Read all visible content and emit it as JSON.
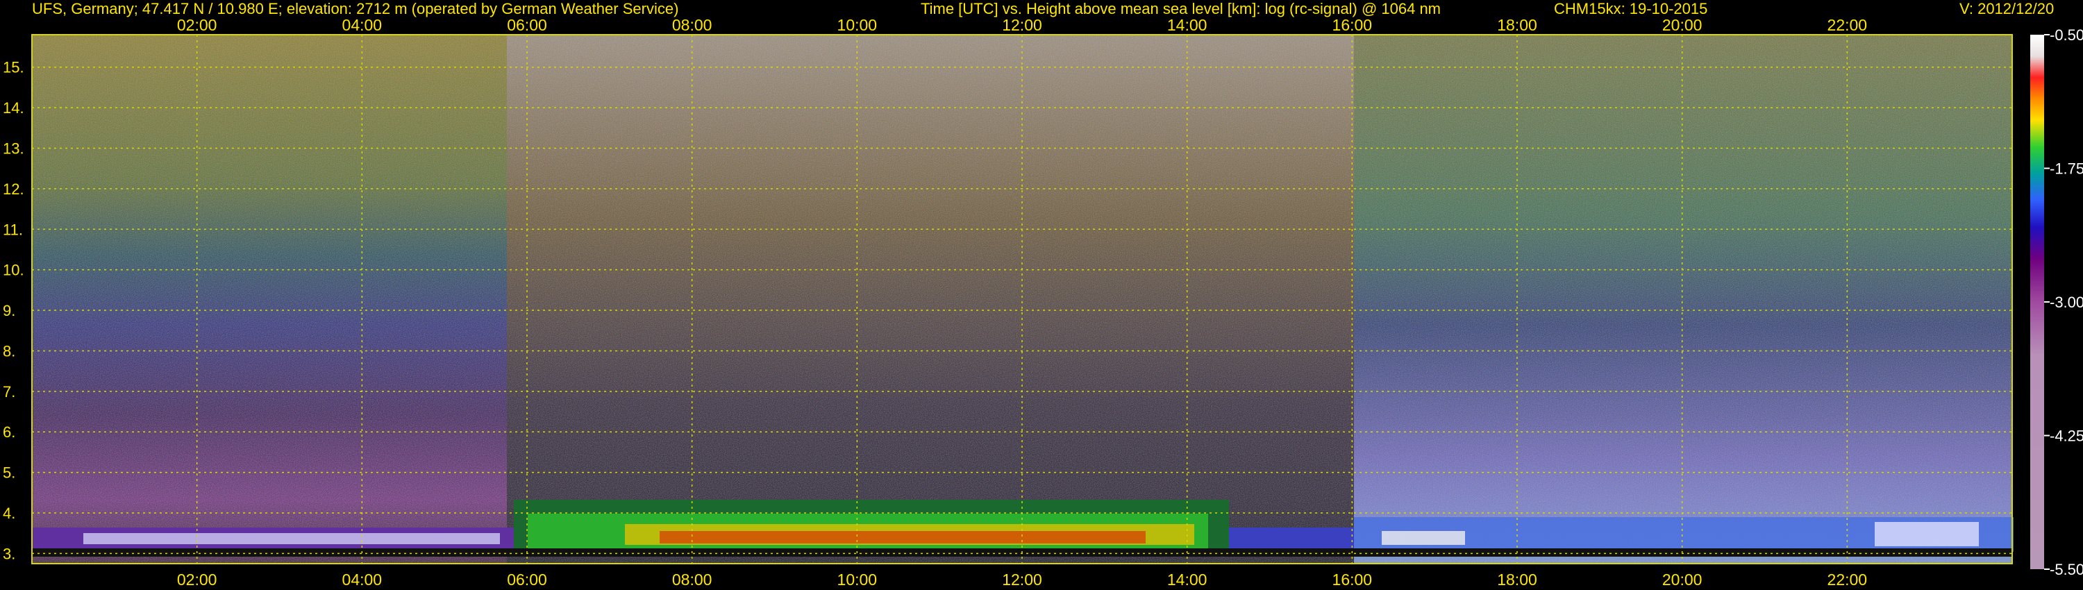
{
  "header": {
    "station": "UFS, Germany; 47.417 N / 10.980 E; elevation: 2712 m  (operated by German Weather Service)",
    "axes_desc": "Time [UTC] vs. Height above mean sea level [km]: log (rc-signal) @ 1064 nm",
    "instrument_date": "CHM15kx: 19-10-2015",
    "version": "V: 2012/12/20"
  },
  "colors": {
    "text": "#ffe600",
    "gridline": "#d8d800",
    "background": "#000000"
  },
  "chart_data": {
    "type": "heatmap",
    "title": "Time [UTC] vs. Height above mean sea level [km]: log (rc-signal) @ 1064 nm",
    "x_ticks": [
      "02:00",
      "04:00",
      "06:00",
      "08:00",
      "10:00",
      "12:00",
      "14:00",
      "16:00",
      "18:00",
      "20:00",
      "22:00"
    ],
    "x_tick_hours": [
      2,
      4,
      6,
      8,
      10,
      12,
      14,
      16,
      18,
      20,
      22
    ],
    "xlim_hours": [
      0,
      24
    ],
    "y_ticks": [
      "3.",
      "4.",
      "5.",
      "6.",
      "7.",
      "8.",
      "9.",
      "10.",
      "11.",
      "12.",
      "13.",
      "14.",
      "15."
    ],
    "y_tick_km": [
      3,
      4,
      5,
      6,
      7,
      8,
      9,
      10,
      11,
      12,
      13,
      14,
      15
    ],
    "ylim_km": [
      2.75,
      15.8
    ],
    "grid": true,
    "colorbar": {
      "ticks": [
        "-0.50",
        "-1.75",
        "-3.00",
        "-4.25",
        "-5.50"
      ],
      "tick_values": [
        -0.5,
        -1.75,
        -3.0,
        -4.25,
        -5.5
      ],
      "range": [
        -5.5,
        -0.5
      ]
    }
  }
}
